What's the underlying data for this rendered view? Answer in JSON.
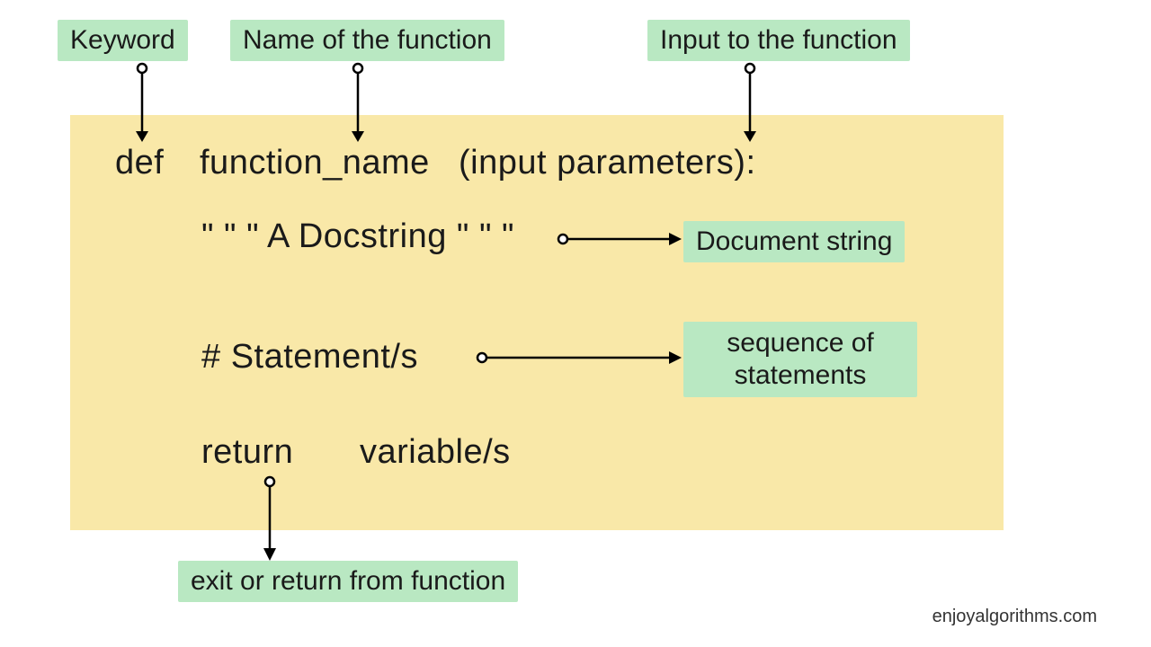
{
  "labels": {
    "keyword": "Keyword",
    "name_of_function": "Name of the function",
    "input_to_function": "Input to the function",
    "document_string": "Document string",
    "sequence_line1": "sequence of",
    "sequence_line2": "statements",
    "exit_return": "exit or return from function"
  },
  "code": {
    "def": "def",
    "function_name": "function_name",
    "params": "(input parameters):",
    "docstring": "\" \" \" A Docstring \" \" \"",
    "statements": "# Statement/s",
    "return_kw": "return",
    "return_var": "variable/s"
  },
  "attribution": "enjoyalgorithms.com"
}
